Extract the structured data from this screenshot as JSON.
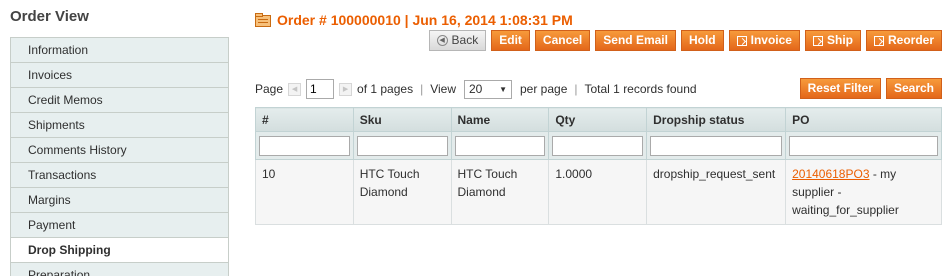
{
  "sidebar": {
    "title": "Order View",
    "items": [
      {
        "label": "Information",
        "active": false
      },
      {
        "label": "Invoices",
        "active": false
      },
      {
        "label": "Credit Memos",
        "active": false
      },
      {
        "label": "Shipments",
        "active": false
      },
      {
        "label": "Comments History",
        "active": false
      },
      {
        "label": "Transactions",
        "active": false
      },
      {
        "label": "Margins",
        "active": false
      },
      {
        "label": "Payment",
        "active": false
      },
      {
        "label": "Drop Shipping",
        "active": true
      },
      {
        "label": "Preparation",
        "active": false
      }
    ]
  },
  "header": {
    "title": "Order # 100000010 | Jun 16, 2014 1:08:31 PM",
    "icon": "order-icon"
  },
  "actions": {
    "back": "Back",
    "edit": "Edit",
    "cancel": "Cancel",
    "send_email": "Send Email",
    "hold": "Hold",
    "invoice": "Invoice",
    "ship": "Ship",
    "reorder": "Reorder"
  },
  "pager": {
    "page_label": "Page",
    "page_value": "1",
    "of_pages": "of 1 pages",
    "view_label": "View",
    "view_value": "20",
    "per_page": "per page",
    "total": "Total 1 records found",
    "separator": "|"
  },
  "filters": {
    "reset": "Reset Filter",
    "search": "Search"
  },
  "grid": {
    "columns": [
      "#",
      "Sku",
      "Name",
      "Qty",
      "Dropship status",
      "PO"
    ],
    "rows": [
      {
        "id": "10",
        "sku": "HTC Touch Diamond",
        "name": "HTC Touch Diamond",
        "qty": "1.0000",
        "status": "dropship_request_sent",
        "po_link": "20140618PO3",
        "po_text": " - my supplier - waiting_for_supplier"
      }
    ]
  },
  "colors": {
    "accent": "#eb5e00",
    "button": "#ef7d1c",
    "header_bg": "#d9e3e4"
  }
}
